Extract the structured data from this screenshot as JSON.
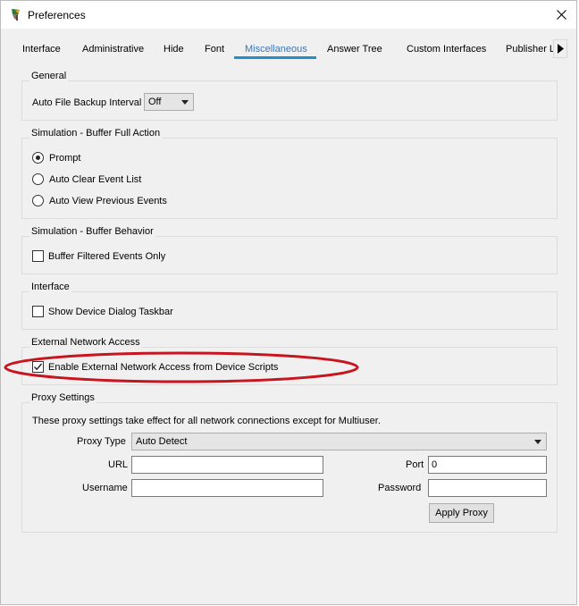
{
  "window": {
    "title": "Preferences"
  },
  "tabs": [
    {
      "label": "Interface"
    },
    {
      "label": "Administrative"
    },
    {
      "label": "Hide"
    },
    {
      "label": "Font"
    },
    {
      "label": "Miscellaneous",
      "active": true
    },
    {
      "label": "Answer Tree"
    },
    {
      "label": "Custom Interfaces"
    },
    {
      "label": "Publisher Li"
    }
  ],
  "general": {
    "title": "General",
    "backup_label": "Auto File Backup Interval",
    "backup_value": "Off"
  },
  "buffer_full": {
    "title": "Simulation - Buffer Full Action",
    "options": [
      {
        "label": "Prompt",
        "selected": true
      },
      {
        "label": "Auto Clear Event List",
        "selected": false
      },
      {
        "label": "Auto View Previous Events",
        "selected": false
      }
    ]
  },
  "buffer_behavior": {
    "title": "Simulation - Buffer Behavior",
    "filtered_label": "Buffer Filtered Events Only",
    "filtered_checked": false
  },
  "interface": {
    "title": "Interface",
    "taskbar_label": "Show Device Dialog Taskbar",
    "taskbar_checked": false
  },
  "external": {
    "title": "External Network Access",
    "enable_label": "Enable External Network Access from Device Scripts",
    "enable_checked": true
  },
  "proxy": {
    "title": "Proxy Settings",
    "note": "These proxy settings take effect for all network connections except for Multiuser.",
    "type_label": "Proxy Type",
    "type_value": "Auto Detect",
    "url_label": "URL",
    "url_value": "",
    "port_label": "Port",
    "port_value": "0",
    "username_label": "Username",
    "username_value": "",
    "password_label": "Password",
    "password_value": "",
    "apply_label": "Apply Proxy"
  },
  "colors": {
    "active_tab_text": "#3a78b7",
    "active_tab_underline": "#1e8fcf",
    "annotation_ellipse": "#c8141e"
  }
}
